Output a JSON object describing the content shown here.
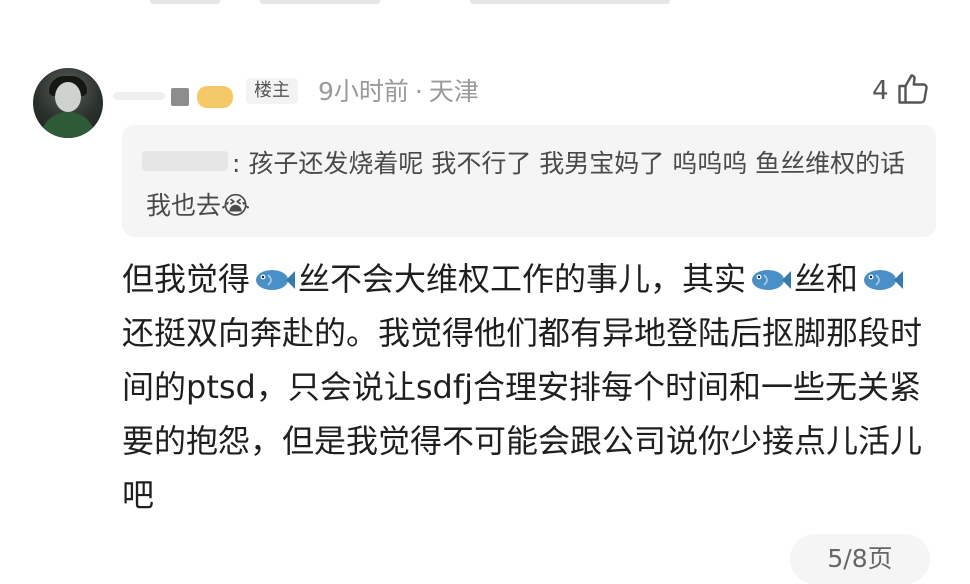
{
  "comment": {
    "op_badge": "楼主",
    "time": "9小时前",
    "location": "天津",
    "meta_separator": "·",
    "likes": "4",
    "quote": {
      "separator": ":",
      "text": "孩子还发烧着呢 我不行了 我男宝妈了 呜呜呜 鱼丝维权的话我也去😭"
    },
    "body": {
      "part1": "但我觉得",
      "part2": "丝不会大维权工作的事儿，其实",
      "part3": "丝和",
      "part4": "还挺双向奔赴的。我觉得他们都有异地登陆后抠脚那段时间的ptsd，只会说让sdfj合理安排每个时间和一些无关紧要的抱怨，但是我觉得不可能会跟公司说你少接点儿活儿吧"
    }
  },
  "pager": {
    "text": "5/8页"
  },
  "icons": {
    "like": "thumbs-up-icon",
    "fish": "fish-emoji-icon"
  },
  "colors": {
    "meta_gray": "#9a9a9a",
    "quote_bg": "#f5f5f5",
    "fish_blue": "#4a8fc6"
  }
}
